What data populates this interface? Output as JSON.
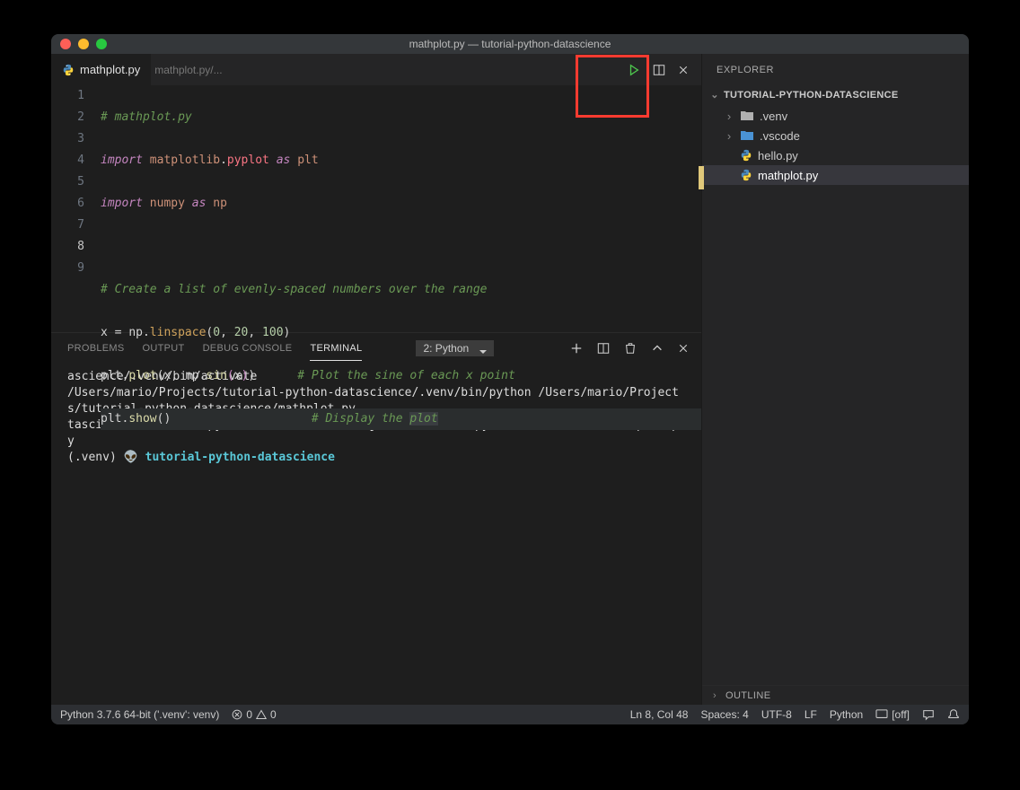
{
  "window": {
    "title": "mathplot.py — tutorial-python-datascience"
  },
  "tab": {
    "filename": "mathplot.py",
    "breadcrumb": "mathplot.py/..."
  },
  "code": {
    "lines": [
      "1",
      "2",
      "3",
      "4",
      "5",
      "6",
      "7",
      "8",
      "9"
    ],
    "l1_comment": "# mathplot.py",
    "l2_import": "import",
    "l2_module": "matplotlib",
    "l2_dot": ".",
    "l2_sub": "pyplot",
    "l2_as": "as",
    "l2_alias": "plt",
    "l3_import": "import",
    "l3_module": "numpy",
    "l3_as": "as",
    "l3_alias": "np",
    "l5_comment": "# Create a list of evenly-spaced numbers over the range",
    "l6_x": "x",
    "l6_eq": " = ",
    "l6_np": "np",
    "l6_dot": ".",
    "l6_func": "linspace",
    "l6_open": "(",
    "l6_n0": "0",
    "l6_c1": ", ",
    "l6_n1": "20",
    "l6_c2": ", ",
    "l6_n2": "100",
    "l6_close": ")",
    "l7_plt": "plt",
    "l7_dot": ".",
    "l7_func": "plot",
    "l7_open": "(",
    "l7_x": "x",
    "l7_c1": ", ",
    "l7_np": "np",
    "l7_dot2": ".",
    "l7_sin": "sin",
    "l7_openi": "(",
    "l7_xi": "x",
    "l7_closei": ")",
    "l7_close": ")",
    "l7_pad": "      ",
    "l7_comment": "# Plot the sine of each x point",
    "l8_plt": "plt",
    "l8_dot": ".",
    "l8_func": "show",
    "l8_open": "(",
    "l8_close": ")",
    "l8_pad": "                    ",
    "l8_comment_a": "# Display the ",
    "l8_comment_b": "plot"
  },
  "panel": {
    "tabs": {
      "problems": "PROBLEMS",
      "output": "OUTPUT",
      "debug": "DEBUG CONSOLE",
      "terminal": "TERMINAL"
    },
    "select": "2: Python",
    "terminal_text": "ascience/.venv/bin/activate\n/Users/mario/Projects/tutorial-python-datascience/.venv/bin/python /Users/mario/Projects/tutorial-python-datascience/mathplot.py\ntascience/.venv/bin/python /Users/mario/Projects/tutorial-python-datascience/mathplot.py\n(.venv) 👽 ",
    "terminal_prompt": "tutorial-python-datascience"
  },
  "explorer": {
    "title": "EXPLORER",
    "project": "TUTORIAL-PYTHON-DATASCIENCE",
    "folders": [
      {
        "name": ".venv"
      },
      {
        "name": ".vscode"
      }
    ],
    "files": [
      {
        "name": "hello.py"
      },
      {
        "name": "mathplot.py"
      }
    ],
    "outline": "OUTLINE"
  },
  "status": {
    "python": "Python 3.7.6 64-bit ('.venv': venv)",
    "err": "0",
    "warn": "0",
    "lncol": "Ln 8, Col 48",
    "spaces": "Spaces: 4",
    "encoding": "UTF-8",
    "eol": "LF",
    "lang": "Python",
    "screencast": "[off]"
  }
}
